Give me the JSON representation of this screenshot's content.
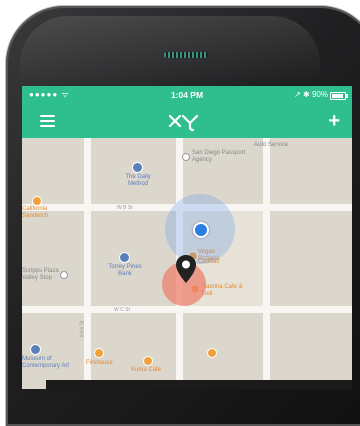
{
  "status": {
    "carrier_dots": "●●●●● ᯤ",
    "time": "1:04 PM",
    "right": "↗ ✱ 90%"
  },
  "nav": {
    "menu_icon": "menu-icon",
    "logo_icon": "xy-logo-icon",
    "add_icon": "plus-icon",
    "add_label": "+"
  },
  "map": {
    "streets": {
      "w_b": "W B St",
      "w_c": "W C St",
      "india": "India St"
    },
    "pois": {
      "san_diego_passport": "San Diego Passport Agency",
      "auto_service": "Auto Service",
      "daily_method": "The Daily Method",
      "california_sandwich": "California Sandwich",
      "torrey_pines_bank": "Torrey Pines Bank",
      "vegan_deli": "Vegan Pizzaria",
      "cadillac": "Cadillac",
      "sabrina": "Sabrina Cafe & Deli",
      "scripps_plaza": "Scripps Plaza Valley Stop",
      "museum": "Museum of Contemporary Art",
      "firehouse": "Firehouse",
      "kuma_cafe": "Kuma Cafe"
    }
  },
  "colors": {
    "header_green": "#2fbf8f",
    "location_blue": "#2a7de1",
    "pin_halo": "#ec806e",
    "poi_orange": "#f2a03d",
    "poi_blue": "#5b7fb8"
  }
}
